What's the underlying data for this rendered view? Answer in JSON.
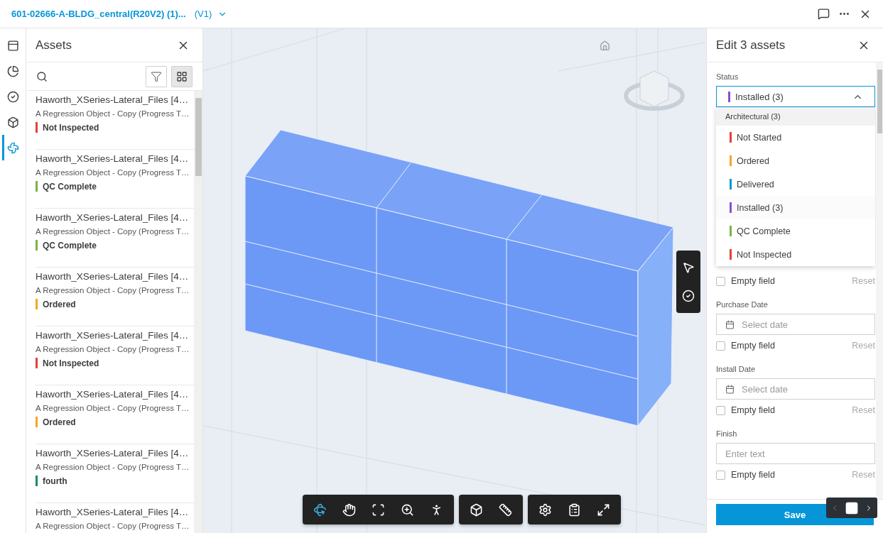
{
  "header": {
    "title": "601-02666-A-BLDG_central(R20V2) (1)...",
    "version": "(V1)"
  },
  "rail": [
    {
      "kind": "sheets",
      "selected": false
    },
    {
      "kind": "pie",
      "selected": false
    },
    {
      "kind": "check",
      "selected": false
    },
    {
      "kind": "cube-search",
      "selected": false
    },
    {
      "kind": "fan",
      "selected": true
    }
  ],
  "assets_panel": {
    "title": "Assets",
    "items": [
      {
        "name": "Haworth_XSeries-Lateral_Files [4…",
        "description": "A Regression Object - Copy (Progress T…",
        "status": "Not Inspected",
        "color": "#e5403a"
      },
      {
        "name": "Haworth_XSeries-Lateral_Files [4…",
        "description": "A Regression Object - Copy (Progress T…",
        "status": "QC Complete",
        "color": "#7cb342"
      },
      {
        "name": "Haworth_XSeries-Lateral_Files [4…",
        "description": "A Regression Object - Copy (Progress T…",
        "status": "QC Complete",
        "color": "#7cb342"
      },
      {
        "name": "Haworth_XSeries-Lateral_Files [4…",
        "description": "A Regression Object - Copy (Progress T…",
        "status": "Ordered",
        "color": "#f5a623"
      },
      {
        "name": "Haworth_XSeries-Lateral_Files [4…",
        "description": "A Regression Object - Copy (Progress T…",
        "status": "Not Inspected",
        "color": "#e5403a"
      },
      {
        "name": "Haworth_XSeries-Lateral_Files [4…",
        "description": "A Regression Object - Copy (Progress T…",
        "status": "Ordered",
        "color": "#f5a623"
      },
      {
        "name": "Haworth_XSeries-Lateral_Files [4…",
        "description": "A Regression Object - Copy (Progress T…",
        "status": "fourth",
        "color": "#1a8a6a"
      },
      {
        "name": "Haworth_XSeries-Lateral_Files [4…",
        "description": "A Regression Object - Copy (Progress T…"
      }
    ]
  },
  "viewer": {
    "side_tools": [
      {
        "kind": "select"
      },
      {
        "kind": "check"
      }
    ],
    "toolbar": [
      [
        {
          "kind": "orbit",
          "selected": true
        },
        {
          "kind": "pan",
          "selected": false
        },
        {
          "kind": "fit",
          "selected": false
        },
        {
          "kind": "zoom",
          "selected": false
        },
        {
          "kind": "walk",
          "selected": false
        }
      ],
      [
        {
          "kind": "section",
          "selected": false
        },
        {
          "kind": "measure",
          "selected": false
        }
      ],
      [
        {
          "kind": "settings",
          "selected": false
        },
        {
          "kind": "properties",
          "selected": false
        },
        {
          "kind": "fullscreen",
          "selected": false
        }
      ]
    ]
  },
  "edit_panel": {
    "title": "Edit 3 assets",
    "fields": [
      {
        "kind": "select",
        "label": "Status",
        "value": "Installed (3)",
        "color": "#8a4fd0",
        "expanded": true,
        "menu": {
          "group": "Architectural (3)",
          "options": [
            {
              "label": "Not Started",
              "color": "#e5403a",
              "selected": false
            },
            {
              "label": "Ordered",
              "color": "#f5a623",
              "selected": false
            },
            {
              "label": "Delivered",
              "color": "#0696d7",
              "selected": false
            },
            {
              "label": "Installed (3)",
              "color": "#8a4fd0",
              "selected": true
            },
            {
              "label": "QC Complete",
              "color": "#7cb342",
              "selected": false
            },
            {
              "label": "Not Inspected",
              "color": "#e5403a",
              "selected": false
            }
          ]
        },
        "empty_label": "Empty field",
        "empty_checked": false,
        "reset": "Reset"
      },
      {
        "kind": "date",
        "label": "Purchase Date",
        "placeholder": "Select date",
        "empty_label": "Empty field",
        "empty_checked": false,
        "reset": "Reset"
      },
      {
        "kind": "date",
        "label": "Install Date",
        "placeholder": "Select date",
        "empty_label": "Empty field",
        "empty_checked": false,
        "reset": "Reset"
      },
      {
        "kind": "text",
        "label": "Finish",
        "placeholder": "Enter text",
        "empty_label": "Empty field",
        "empty_checked": false,
        "reset": "Reset"
      }
    ],
    "save": "Save"
  }
}
